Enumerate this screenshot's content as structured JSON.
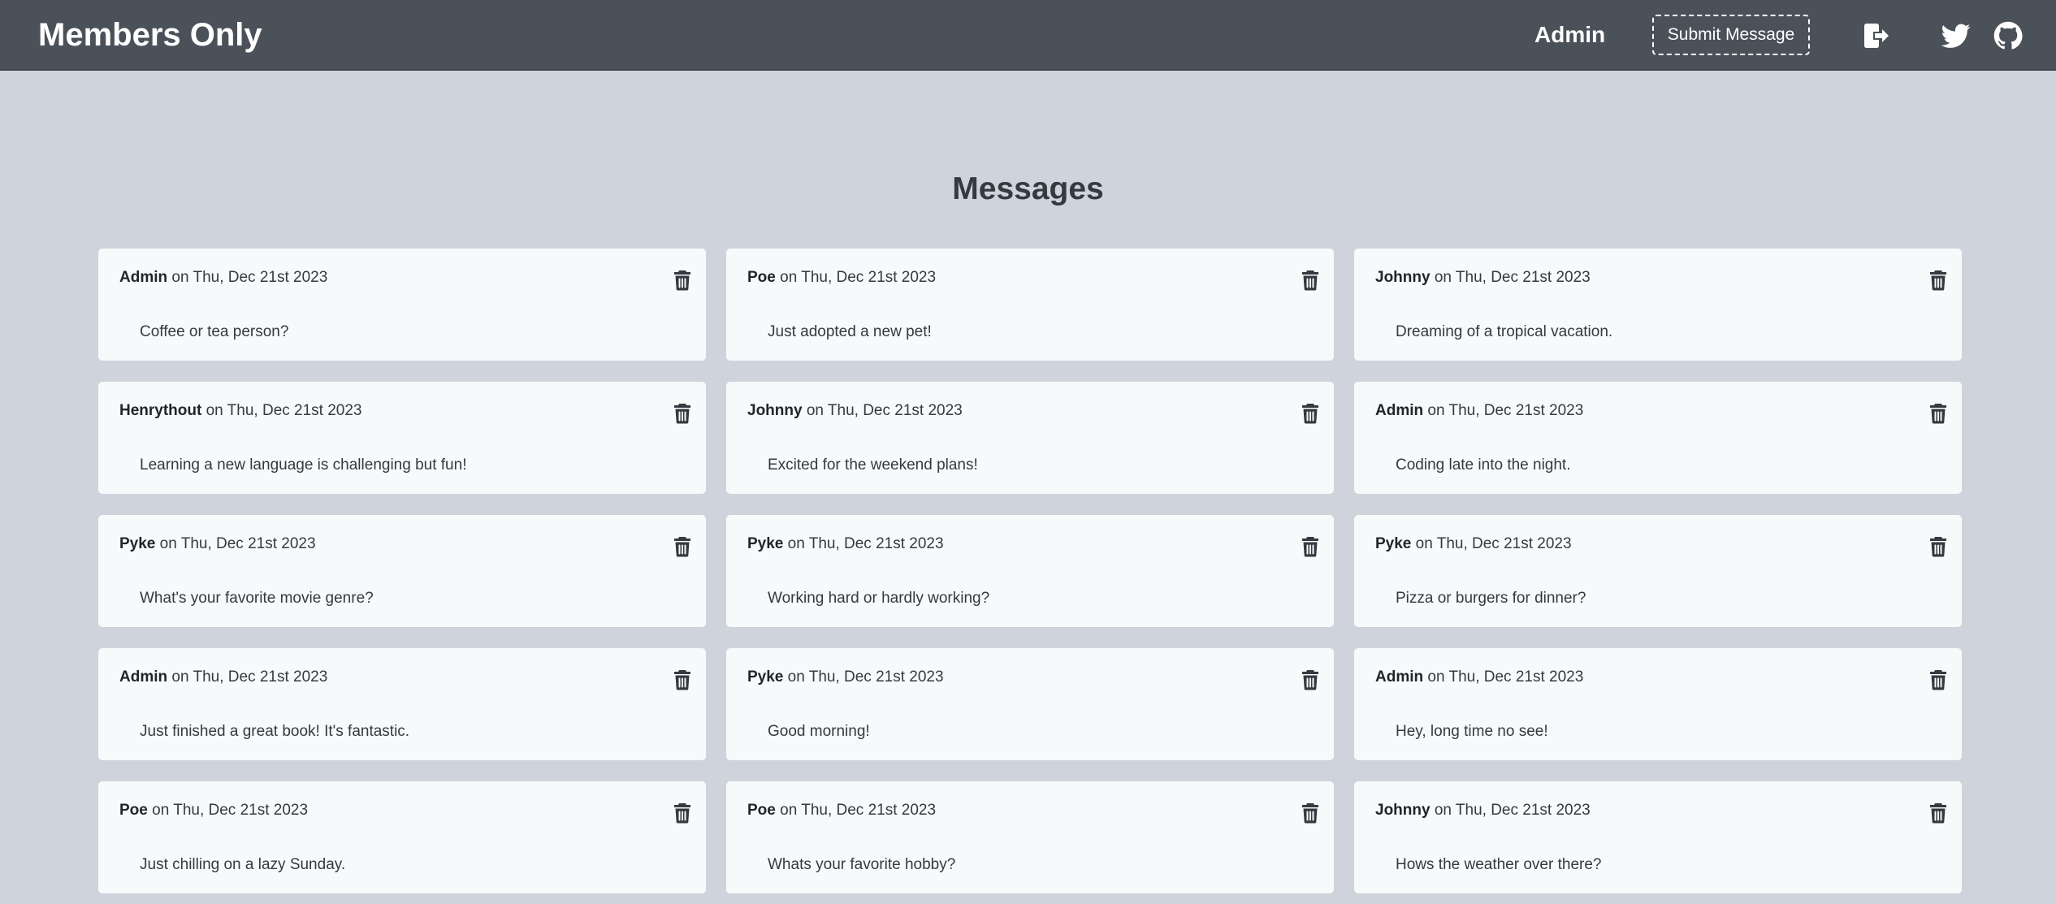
{
  "header": {
    "brand": "Members Only",
    "user": "Admin",
    "submit_label": "Submit Message",
    "icons": [
      "logout-icon",
      "twitter-icon",
      "github-icon"
    ]
  },
  "main": {
    "title": "Messages",
    "messages": [
      {
        "author": "Admin",
        "date": "on Thu, Dec 21st 2023",
        "text": "Coffee or tea person?"
      },
      {
        "author": "Poe",
        "date": "on Thu, Dec 21st 2023",
        "text": "Just adopted a new pet!"
      },
      {
        "author": "Johnny",
        "date": "on Thu, Dec 21st 2023",
        "text": "Dreaming of a tropical vacation."
      },
      {
        "author": "Henrythout",
        "date": "on Thu, Dec 21st 2023",
        "text": "Learning a new language is challenging but fun!"
      },
      {
        "author": "Johnny",
        "date": "on Thu, Dec 21st 2023",
        "text": "Excited for the weekend plans!"
      },
      {
        "author": "Admin",
        "date": "on Thu, Dec 21st 2023",
        "text": "Coding late into the night."
      },
      {
        "author": "Pyke",
        "date": "on Thu, Dec 21st 2023",
        "text": "What's your favorite movie genre?"
      },
      {
        "author": "Pyke",
        "date": "on Thu, Dec 21st 2023",
        "text": "Working hard or hardly working?"
      },
      {
        "author": "Pyke",
        "date": "on Thu, Dec 21st 2023",
        "text": "Pizza or burgers for dinner?"
      },
      {
        "author": "Admin",
        "date": "on Thu, Dec 21st 2023",
        "text": "Just finished a great book! It's fantastic."
      },
      {
        "author": "Pyke",
        "date": "on Thu, Dec 21st 2023",
        "text": "Good morning!"
      },
      {
        "author": "Admin",
        "date": "on Thu, Dec 21st 2023",
        "text": "Hey, long time no see!"
      },
      {
        "author": "Poe",
        "date": "on Thu, Dec 21st 2023",
        "text": "Just chilling on a lazy Sunday."
      },
      {
        "author": "Poe",
        "date": "on Thu, Dec 21st 2023",
        "text": "Whats your favorite hobby?"
      },
      {
        "author": "Johnny",
        "date": "on Thu, Dec 21st 2023",
        "text": "Hows the weather over there?"
      }
    ]
  },
  "colors": {
    "navbar": "#4b5159",
    "page_background": "#cfd4dc",
    "card_background": "#f7f9fa",
    "text": "#343a40"
  }
}
